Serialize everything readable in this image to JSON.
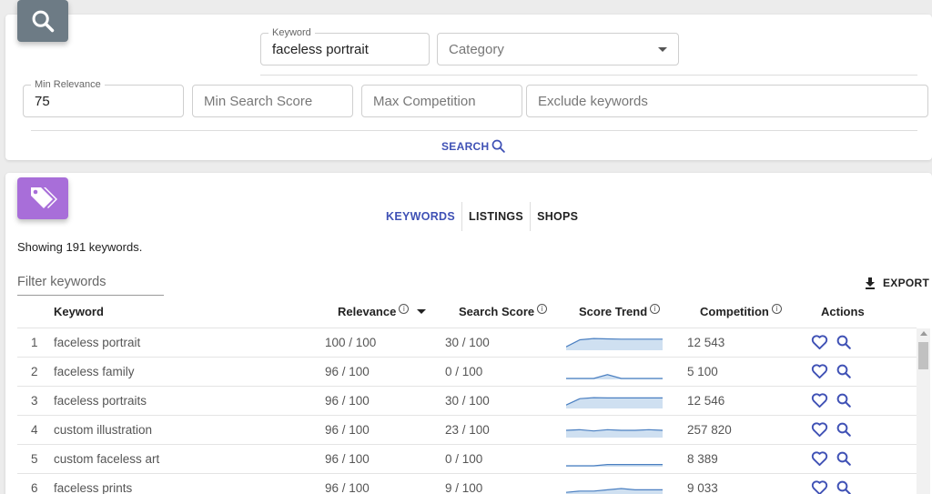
{
  "search": {
    "keyword_label": "Keyword",
    "keyword_value": "faceless portrait",
    "category_placeholder": "Category",
    "min_relevance_label": "Min Relevance",
    "min_relevance_value": "75",
    "min_search_score_placeholder": "Min Search Score",
    "max_competition_placeholder": "Max Competition",
    "exclude_keywords_placeholder": "Exclude keywords",
    "search_button": "SEARCH"
  },
  "tabs": [
    "KEYWORDS",
    "LISTINGS",
    "SHOPS"
  ],
  "active_tab": "KEYWORDS",
  "results": {
    "showing_text": "Showing 191 keywords.",
    "filter_placeholder": "Filter keywords",
    "export_label": "EXPORT",
    "columns": {
      "keyword": "Keyword",
      "relevance": "Relevance",
      "search_score": "Search Score",
      "score_trend": "Score Trend",
      "competition": "Competition",
      "actions": "Actions"
    },
    "sort": {
      "column": "relevance",
      "direction": "descending"
    },
    "rows": [
      {
        "num": "1",
        "keyword": "faceless portrait",
        "relevance": "100 / 100",
        "search_score": "30 / 100",
        "competition": "12 543",
        "trend": [
          0.2,
          0.75,
          0.85,
          0.82,
          0.8,
          0.8,
          0.8,
          0.8
        ]
      },
      {
        "num": "2",
        "keyword": "faceless family",
        "relevance": "96 / 100",
        "search_score": "0 / 100",
        "competition": "5 100",
        "trend": [
          0,
          0,
          0,
          0.3,
          0,
          0,
          0,
          0
        ]
      },
      {
        "num": "3",
        "keyword": "faceless portraits",
        "relevance": "96 / 100",
        "search_score": "30 / 100",
        "competition": "12 546",
        "trend": [
          0.2,
          0.7,
          0.78,
          0.76,
          0.76,
          0.76,
          0.76,
          0.76
        ]
      },
      {
        "num": "4",
        "keyword": "custom illustration",
        "relevance": "96 / 100",
        "search_score": "23 / 100",
        "competition": "257 820",
        "trend": [
          0.5,
          0.55,
          0.45,
          0.55,
          0.5,
          0.5,
          0.55,
          0.5
        ]
      },
      {
        "num": "5",
        "keyword": "custom faceless art",
        "relevance": "96 / 100",
        "search_score": "0 / 100",
        "competition": "8 389",
        "trend": [
          0,
          0,
          0,
          0.1,
          0.1,
          0.1,
          0.1,
          0.1
        ]
      },
      {
        "num": "6",
        "keyword": "faceless prints",
        "relevance": "96 / 100",
        "search_score": "9 / 100",
        "competition": "9 033",
        "trend": [
          0.2,
          0.3,
          0.3,
          0.4,
          0.5,
          0.4,
          0.4,
          0.4
        ]
      }
    ]
  },
  "icons": {
    "search_badge": "search-icon",
    "results_badge": "tags-icon",
    "favorite": "heart-icon",
    "lookup": "search-icon",
    "export": "download-icon",
    "info": "info-icon"
  },
  "colors": {
    "accent": "#3f51b5",
    "search_badge_bg": "#6d7b85",
    "tags_badge_bg": "#a86ed9",
    "trend_stroke": "#4a7fc1",
    "trend_fill": "#cfe0f1"
  }
}
